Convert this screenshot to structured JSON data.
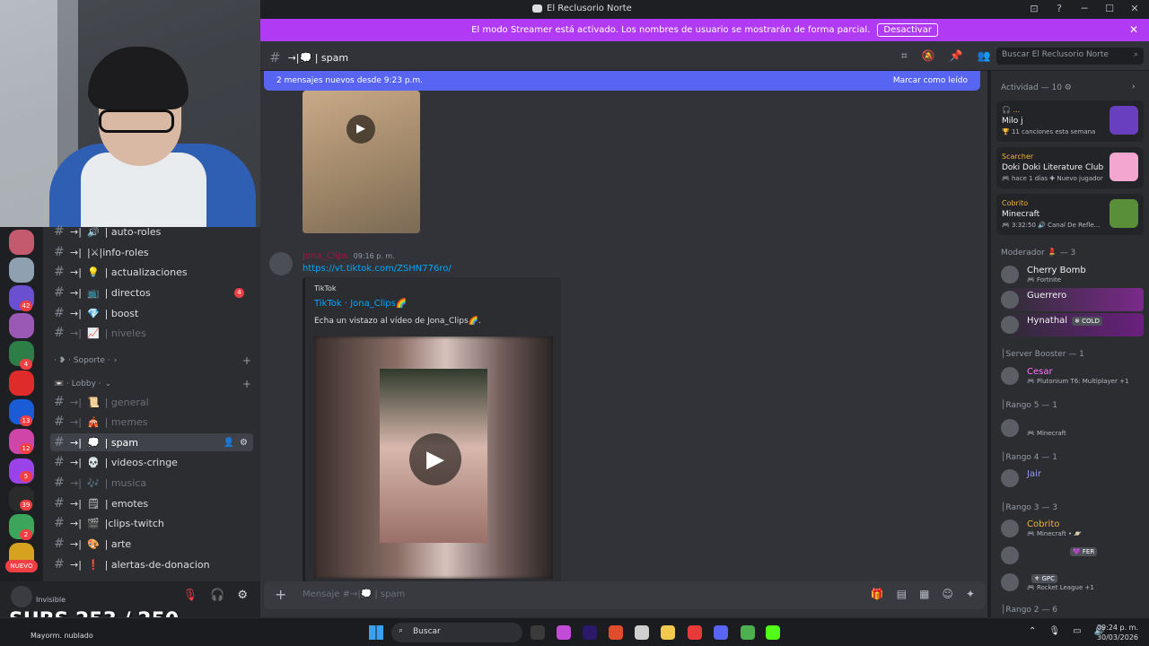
{
  "window": {
    "title": "El Reclusorio Norte",
    "controls": [
      "⊡",
      "?",
      "─",
      "☐",
      "✕"
    ]
  },
  "streamer_banner": {
    "text": "El modo Streamer está activado. Los nombres de usuario se mostrarán de forma parcial.",
    "button": "Desactivar",
    "close": "✕"
  },
  "rail": {
    "badges": [
      "42",
      "4",
      "13",
      "12",
      "5",
      "39",
      "2"
    ],
    "nuevo": "NUEVO",
    "colors": [
      "#c45a6e",
      "#8fa0b0",
      "#6a4fd0",
      "#9b59b6",
      "#2d7d46",
      "#e02b2b",
      "#1a5cd6",
      "#d046a8",
      "#9a43e8",
      "#2b2b2b",
      "#3ba55c",
      "#d6a21f"
    ]
  },
  "sidebar": {
    "channels_top": [
      {
        "prefix": "→|",
        "emoji": "🔊",
        "name": "| auto-roles",
        "muted": false
      },
      {
        "prefix": "→|",
        "emoji": "",
        "name": "|⚔|info-roles",
        "muted": false
      },
      {
        "prefix": "→|",
        "emoji": "💡",
        "name": "| actualizaciones",
        "muted": false
      },
      {
        "prefix": "→|",
        "emoji": "📺",
        "name": "| directos",
        "muted": false,
        "badge": "4"
      },
      {
        "prefix": "→|",
        "emoji": "💎",
        "name": "| boost",
        "muted": false
      },
      {
        "prefix": "→|",
        "emoji": "📈",
        "name": "| niveles",
        "muted": true
      }
    ],
    "categories": [
      {
        "label": "· ❥ · Soporte ·",
        "chev": "›"
      },
      {
        "label": "📼 · Lobby ·",
        "chev": "⌄"
      }
    ],
    "channels_lobby": [
      {
        "prefix": "→|",
        "emoji": "📜",
        "name": "| general",
        "muted": true
      },
      {
        "prefix": "→|",
        "emoji": "🎪",
        "name": "| memes",
        "muted": true
      },
      {
        "prefix": "→|",
        "emoji": "💭",
        "name": "| spam",
        "muted": false,
        "active": true
      },
      {
        "prefix": "→|",
        "emoji": "💀",
        "name": "| videos-cringe",
        "muted": false
      },
      {
        "prefix": "→|",
        "emoji": "🎶",
        "name": "| musica",
        "muted": true
      },
      {
        "prefix": "→|",
        "emoji": "🗒",
        "name": "| emotes",
        "muted": false
      },
      {
        "prefix": "→|",
        "emoji": "🎬",
        "name": "|clips-twitch",
        "muted": false
      },
      {
        "prefix": "→|",
        "emoji": "🎨",
        "name": "| arte",
        "muted": false
      },
      {
        "prefix": "→|",
        "emoji": "❗",
        "name": "| alertas-de-donacion",
        "muted": false
      }
    ]
  },
  "user_panel": {
    "status": "Invisible"
  },
  "channel_header": {
    "name": "→|💭 | spam",
    "search_placeholder": "Buscar El Reclusorio Norte"
  },
  "new_messages": {
    "text": "2 mensajes nuevos desde 9:23 p.m.",
    "mark": "Marcar como leído"
  },
  "message": {
    "author": "Jona_Clips",
    "time": "09:16 p. m.",
    "link": "https://vt.tiktok.com/ZSHN776ro/",
    "embed": {
      "provider": "TikTok",
      "title": "TikTok · Jona_Clips🌈",
      "description": "Echa un vistazo al vídeo de Jona_Clips🌈."
    }
  },
  "composer": {
    "placeholder": "Mensaje #→|💭 | spam"
  },
  "activity": {
    "header": "Actividad — 10",
    "cards": [
      {
        "who": "🎧 ...",
        "what": "Milo j",
        "meta": "🏆 11 canciones esta semana",
        "thumb_color": "#6a3fbf"
      },
      {
        "who": "Scarcher",
        "what": "Doki Doki Literature Club",
        "meta": "🎮 hace 1 días  ✚ Nuevo jugador",
        "thumb_color": "#f3a6cf"
      },
      {
        "who": "Cobrito",
        "what": "Minecraft",
        "meta": "🎮 3:32:50  🔊 Canal De Refle...",
        "thumb_color": "#5a8f3a"
      }
    ]
  },
  "members": {
    "group_moderador": "Moderador 💄 — 3",
    "moderadores": [
      {
        "name": "Cherry Bomb",
        "sub": "🎮 Fortnite",
        "color": "#f2f3f5"
      },
      {
        "name": "Guerrero",
        "sub": "",
        "color": "#f2f3f5",
        "highlight": "#7a2a8a"
      },
      {
        "name": "Hynathal",
        "sub": "",
        "tag": "❄ COLD",
        "color": "#f2f3f5",
        "highlight": "#6a1f7f"
      }
    ],
    "group_booster": "│Server Booster — 1",
    "boosters": [
      {
        "name": "Cesar",
        "sub": "🎮 Plutonium T6: Multiplayer +1",
        "color": "#ff73fa"
      }
    ],
    "group_rango5": "│Rango 5 — 1",
    "rango5": [
      {
        "name": "",
        "sub": "🎮 Minecraft",
        "color": "#f2f3f5"
      }
    ],
    "group_rango4": "│Rango 4 — 1",
    "rango4": [
      {
        "name": "Jair",
        "sub": "",
        "color": "#949cf7"
      }
    ],
    "group_rango3": "│Rango 3 — 3",
    "rango3": [
      {
        "name": "Cobrito",
        "sub": "🎮 Minecraft • 🪐",
        "color": "#f0b232"
      },
      {
        "name": "Terroriko",
        "sub": "",
        "tag": "💜 FER",
        "color": "#2b2d31"
      },
      {
        "name": "",
        "sub": "🎮 Rocket League +1",
        "tag": "⚜ GPC",
        "color": "#f2f3f5"
      }
    ],
    "group_rango2": "│Rango 2 — 6"
  },
  "overlay": {
    "subs": "SUBS 253 / 250"
  },
  "taskbar": {
    "weather": "Mayorm. nublado",
    "search": "Buscar",
    "time": "09:24 p. m.",
    "date": "30/03/2026",
    "apps": [
      "#3a3a3a",
      "#c24bd8",
      "#2b1a6b",
      "#e14d2a",
      "#cfcfcf",
      "#f2c94c",
      "#e83a3a",
      "#5865f2",
      "#4caf50",
      "#53fc18"
    ]
  }
}
